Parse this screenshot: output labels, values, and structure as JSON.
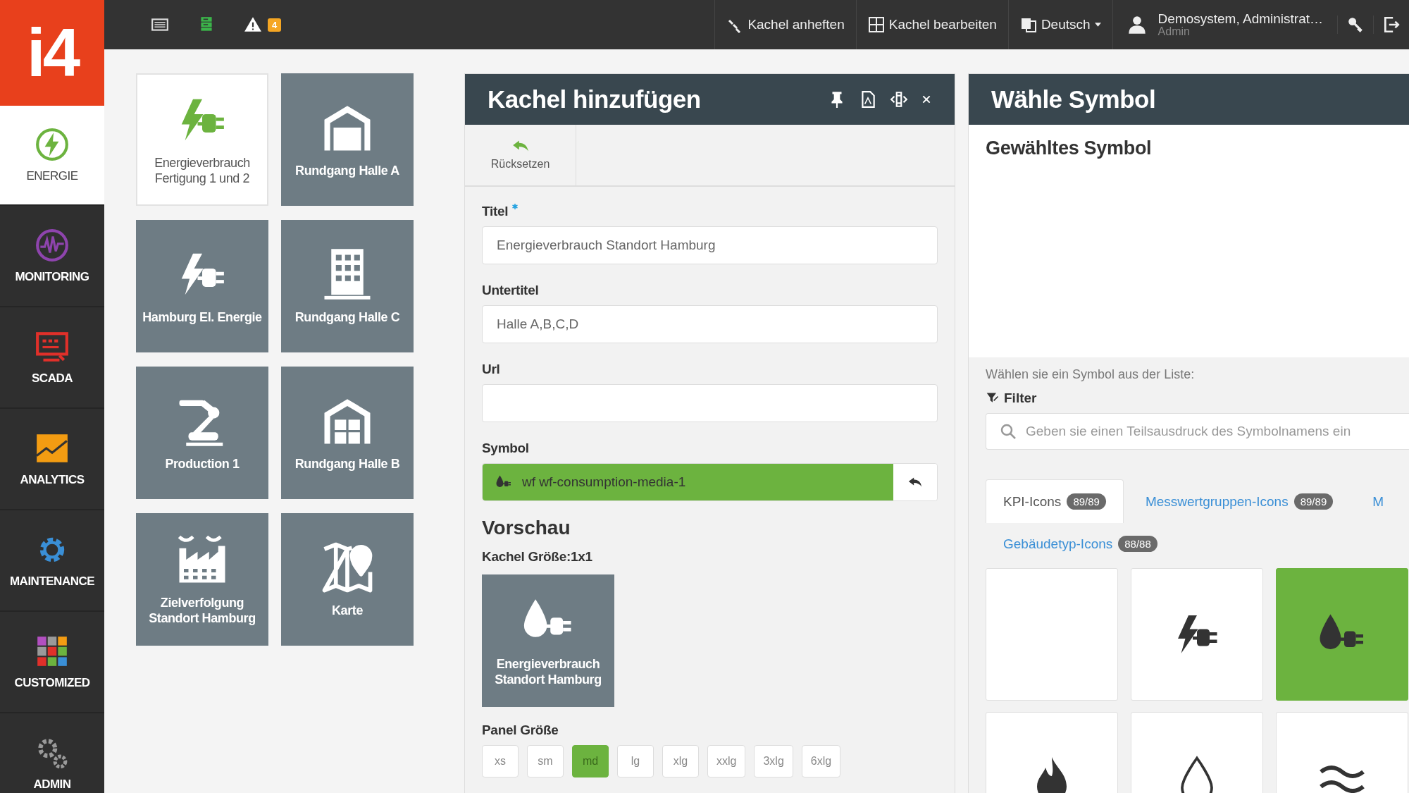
{
  "topbar": {
    "logo": "i4",
    "tools": [
      {
        "kind": "list"
      },
      {
        "kind": "server"
      },
      {
        "kind": "warning",
        "badge": "4"
      }
    ],
    "actions": [
      {
        "kind": "pin",
        "label": "Kachel anheften"
      },
      {
        "kind": "grid",
        "label": "Kachel bearbeiten"
      },
      {
        "kind": "language",
        "label": "Deutsch"
      }
    ],
    "user": {
      "name": "Demosystem, Administrat…",
      "role": "Admin"
    }
  },
  "sidebar": {
    "items": [
      {
        "label": "ENERGIE",
        "kind": "energy",
        "color": "#6cb33f",
        "selected": true
      },
      {
        "label": "MONITORING",
        "kind": "monitoring",
        "color": "#8e44ad",
        "selected": false
      },
      {
        "label": "SCADA",
        "kind": "scada",
        "color": "#e0302a",
        "selected": false
      },
      {
        "label": "ANALYTICS",
        "kind": "analytics",
        "color": "#f39c12",
        "selected": false
      },
      {
        "label": "MAINTENANCE",
        "kind": "maintenance",
        "color": "#3a8fd6",
        "selected": false
      },
      {
        "label": "CUSTOMIZED",
        "kind": "customized",
        "color": "#e0302a",
        "selected": false
      },
      {
        "label": "ADMIN",
        "kind": "admin",
        "color": "#9a9a9a",
        "selected": false
      }
    ]
  },
  "tiles": [
    {
      "title": "Energieverbrauch Fertigung 1 und 2",
      "kind": "energy",
      "selected": true
    },
    {
      "title": "Rundgang Halle A",
      "kind": "hall",
      "selected": false
    },
    {
      "title": "Hamburg El. Energie",
      "kind": "energy",
      "selected": false
    },
    {
      "title": "Rundgang Halle C",
      "kind": "office",
      "selected": false
    },
    {
      "title": "Production 1",
      "kind": "robot",
      "selected": false
    },
    {
      "title": "Rundgang Halle B",
      "kind": "hallb",
      "selected": false
    },
    {
      "title": "Zielverfolgung Standort Hamburg",
      "kind": "factory",
      "selected": false
    },
    {
      "title": "Karte",
      "kind": "map",
      "selected": false
    }
  ],
  "add_panel": {
    "title": "Kachel hinzufügen",
    "reset": "Rücksetzen",
    "fields": [
      {
        "label": "Titel",
        "required": true,
        "value": "Energieverbrauch Standort Hamburg"
      },
      {
        "label": "Untertitel",
        "required": false,
        "value": "Halle A,B,C,D"
      },
      {
        "label": "Url",
        "required": false
      }
    ],
    "symbol": {
      "label": "Symbol",
      "value": "wf wf-consumption-media-1",
      "kind": "dropplug"
    },
    "preview": {
      "heading": "Vorschau",
      "size": "Kachel Größe:1x1",
      "tile": {
        "title": "Energieverbrauch Standort Hamburg",
        "kind": "dropplug"
      }
    },
    "panel_size": {
      "label": "Panel Größe",
      "options": [
        {
          "label": "xs",
          "selected": false
        },
        {
          "label": "sm",
          "selected": false
        },
        {
          "label": "md",
          "selected": true
        },
        {
          "label": "lg",
          "selected": false
        },
        {
          "label": "xlg",
          "selected": false
        },
        {
          "label": "xxlg",
          "selected": false
        },
        {
          "label": "3xlg",
          "selected": false
        },
        {
          "label": "6xlg",
          "selected": false
        }
      ]
    }
  },
  "symbol_panel": {
    "title": "Wähle Symbol",
    "chosen_heading": "Gewähltes Symbol",
    "hint": "Wählen sie ein Symbol aus der Liste:",
    "filter": "Filter",
    "search": {
      "placeholder": "Geben sie einen Teilsausdruck des Symbolnamens ein"
    },
    "tabs": [
      {
        "label": "KPI-Icons",
        "count": "89/89",
        "selected": true
      },
      {
        "label": "Messwertgruppen-Icons",
        "count": "89/89",
        "selected": false
      },
      {
        "label": "M",
        "selected": false
      },
      {
        "label": "Gebäudetyp-Icons",
        "count": "88/88",
        "selected": false
      }
    ],
    "symbols": [
      {
        "kind": "empty",
        "selected": false
      },
      {
        "kind": "energy",
        "selected": false
      },
      {
        "kind": "dropplug",
        "selected": true
      },
      {
        "kind": "flame",
        "selected": false
      },
      {
        "kind": "drop",
        "selected": false
      },
      {
        "kind": "waves",
        "selected": false
      }
    ]
  }
}
